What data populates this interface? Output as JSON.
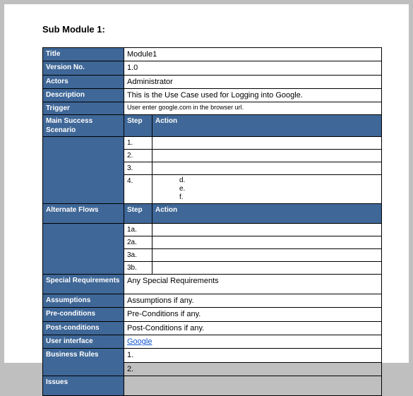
{
  "heading": "Sub Module 1:",
  "rows": {
    "title_label": "Title",
    "title_value": "Module1",
    "version_label": "Version No.",
    "version_value": "1.0",
    "actors_label": "Actors",
    "actors_value": "Administrator",
    "description_label": "Description",
    "description_value": "This is the Use Case used for Logging into Google.",
    "trigger_label": "Trigger",
    "trigger_value": "User enter google.com in the browser url.",
    "main_label": "Main Success Scenario",
    "step_head": "Step",
    "action_head": "Action",
    "main_steps": [
      "1.",
      "2.",
      "3.",
      "4."
    ],
    "main_sub": [
      "d.",
      "e.",
      "f."
    ],
    "alt_label": "Alternate Flows",
    "alt_steps": [
      "1a.",
      "2a.",
      "3a.",
      "3b."
    ],
    "special_label": "Special Requirements",
    "special_value": "Any Special Requirements",
    "assumptions_label": "Assumptions",
    "assumptions_value": "Assumptions if any.",
    "pre_label": "Pre-conditions",
    "pre_value": "Pre-Conditions if any.",
    "post_label": "Post-conditions",
    "post_value": "Post-Conditions if any.",
    "ui_label": "User interface",
    "ui_value": "Google",
    "br_label": "Business Rules",
    "br_steps": [
      "1.",
      "2."
    ],
    "issues_label": "Issues"
  }
}
